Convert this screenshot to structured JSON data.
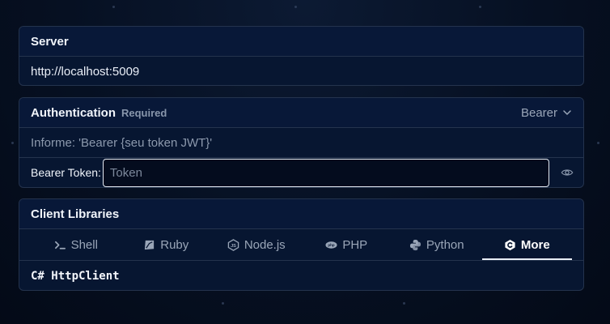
{
  "server": {
    "title": "Server",
    "url": "http://localhost:5009"
  },
  "auth": {
    "title": "Authentication",
    "required": "Required",
    "scheme": "Bearer",
    "hint": "Informe: 'Bearer {seu token JWT}'",
    "token_label": "Bearer Token:",
    "token_placeholder": "Token",
    "token_value": ""
  },
  "libs": {
    "title": "Client Libraries",
    "tabs": [
      {
        "label": "Shell",
        "icon": "terminal-icon"
      },
      {
        "label": "Ruby",
        "icon": "ruby-icon"
      },
      {
        "label": "Node.js",
        "icon": "nodejs-icon"
      },
      {
        "label": "PHP",
        "icon": "php-icon"
      },
      {
        "label": "Python",
        "icon": "python-icon"
      },
      {
        "label": "More",
        "icon": "csharp-icon",
        "active": true
      }
    ],
    "selected_client": "C# HttpClient"
  },
  "colors": {
    "background": "#061022",
    "card": "#071631",
    "border": "#24334d",
    "muted_text": "#9aa6b8",
    "active_tab": "#ffffff"
  }
}
